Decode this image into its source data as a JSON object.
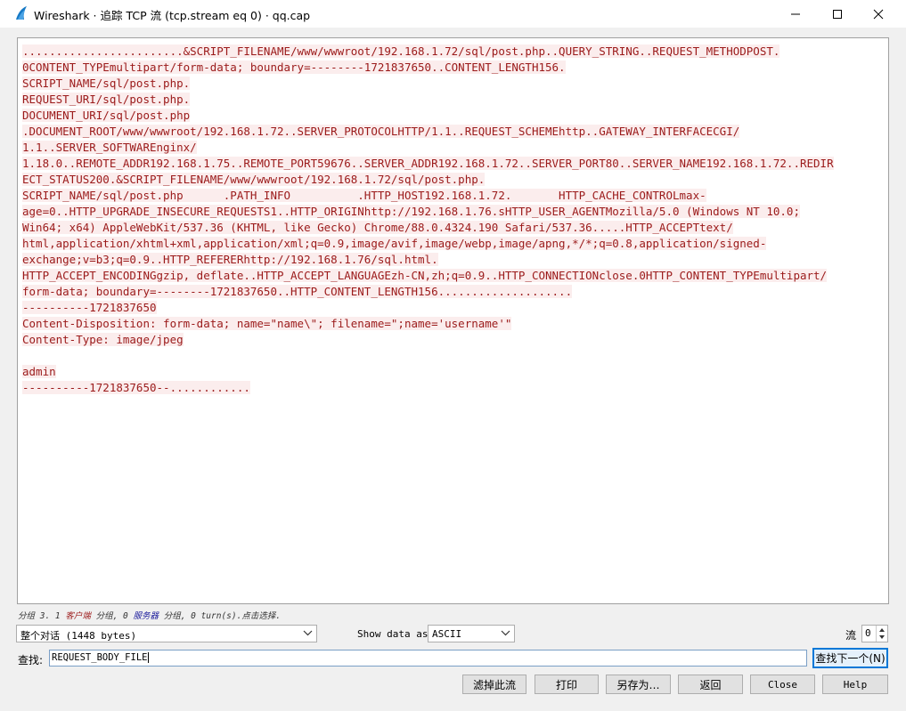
{
  "window": {
    "title": "Wireshark · 追踪 TCP 流 (tcp.stream eq 0) · qq.cap"
  },
  "stream_lines": [
    "........................&SCRIPT_FILENAME/www/wwwroot/192.168.1.72/sql/post.php..QUERY_STRING..REQUEST_METHODPOST.",
    "0CONTENT_TYPEmultipart/form-data; boundary=--------1721837650..CONTENT_LENGTH156.",
    "SCRIPT_NAME/sql/post.php.",
    "REQUEST_URI/sql/post.php.",
    "DOCUMENT_URI/sql/post.php",
    ".DOCUMENT_ROOT/www/wwwroot/192.168.1.72..SERVER_PROTOCOLHTTP/1.1..REQUEST_SCHEMEhttp..GATEWAY_INTERFACECGI/",
    "1.1..SERVER_SOFTWAREnginx/",
    "1.18.0..REMOTE_ADDR192.168.1.75..REMOTE_PORT59676..SERVER_ADDR192.168.1.72..SERVER_PORT80..SERVER_NAME192.168.1.72..REDIR",
    "ECT_STATUS200.&SCRIPT_FILENAME/www/wwwroot/192.168.1.72/sql/post.php.",
    "SCRIPT_NAME/sql/post.php      .PATH_INFO          .HTTP_HOST192.168.1.72.       HTTP_CACHE_CONTROLmax-",
    "age=0..HTTP_UPGRADE_INSECURE_REQUESTS1..HTTP_ORIGINhttp://192.168.1.76.sHTTP_USER_AGENTMozilla/5.0 (Windows NT 10.0;",
    "Win64; x64) AppleWebKit/537.36 (KHTML, like Gecko) Chrome/88.0.4324.190 Safari/537.36.....HTTP_ACCEPTtext/",
    "html,application/xhtml+xml,application/xml;q=0.9,image/avif,image/webp,image/apng,*/*;q=0.8,application/signed-",
    "exchange;v=b3;q=0.9..HTTP_REFERERhttp://192.168.1.76/sql.html.",
    "HTTP_ACCEPT_ENCODINGgzip, deflate..HTTP_ACCEPT_LANGUAGEzh-CN,zh;q=0.9..HTTP_CONNECTIONclose.0HTTP_CONTENT_TYPEmultipart/",
    "form-data; boundary=--------1721837650..HTTP_CONTENT_LENGTH156....................",
    "----------1721837650",
    "Content-Disposition: form-data; name=\"name\\\"; filename=\";name='username'\"",
    "Content-Type: image/jpeg",
    "",
    "admin",
    "----------1721837650--............"
  ],
  "status": {
    "prefix": "分组 3. 1 ",
    "client_label": "客户端",
    "middle": " 分组, 0 ",
    "server_label": "服务器",
    "suffix": " 分组, 0 turn(s).点击选择."
  },
  "controls": {
    "conversation_select": "整个对话 (1448 bytes)",
    "show_data_as_label": "Show data as",
    "format_select": "ASCII",
    "stream_label": "流",
    "stream_value": "0",
    "find_label": "查找:",
    "find_value": "REQUEST_BODY_FILE",
    "find_next_button": "查找下一个(N)"
  },
  "buttons": {
    "filter_out": "滤掉此流",
    "print": "打印",
    "save_as": "另存为…",
    "back": "返回",
    "close": "Close",
    "help": "Help"
  },
  "icons": {
    "app": "wireshark-fin-icon",
    "minimize": "minimize-icon",
    "maximize": "maximize-icon",
    "close": "close-icon"
  },
  "colors": {
    "client_text": "#9b1a1a",
    "client_bg": "#fbeded",
    "server_text": "#1a1a9b",
    "focus": "#0078d7"
  }
}
